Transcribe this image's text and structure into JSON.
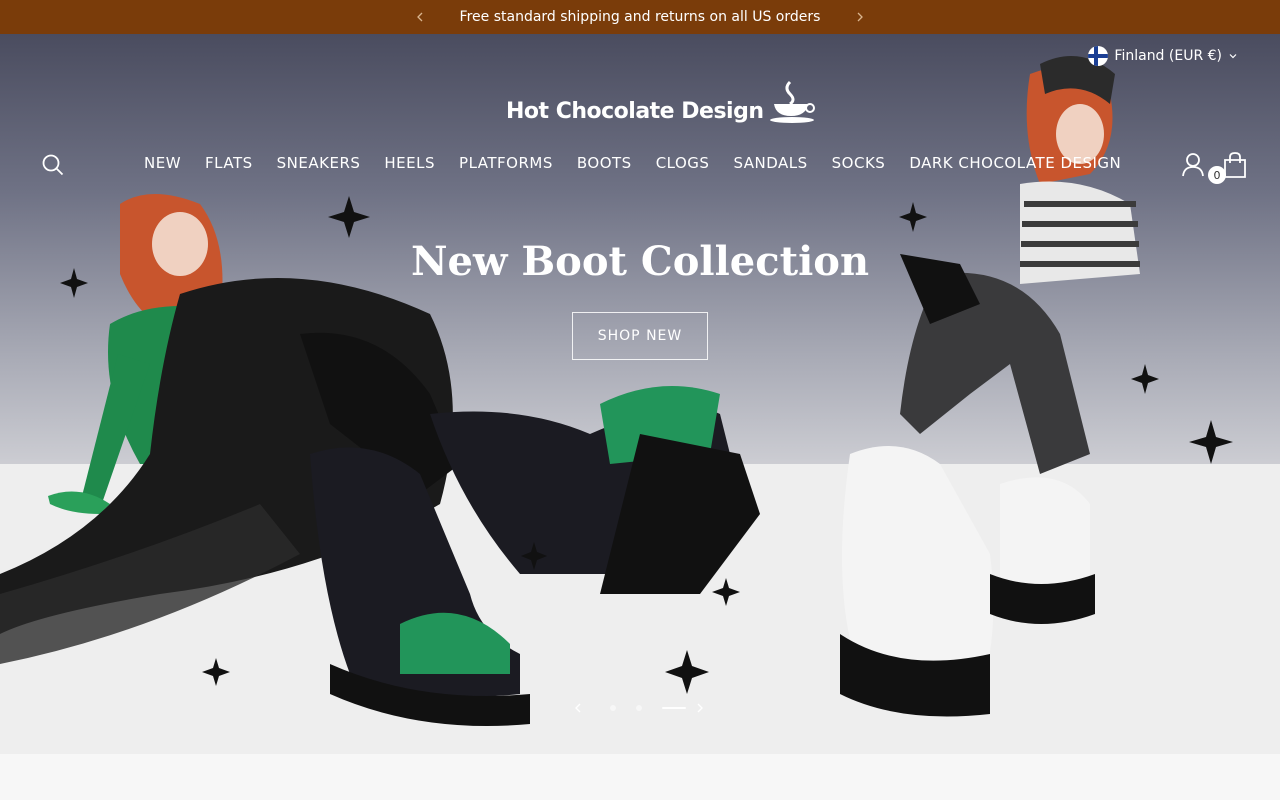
{
  "announcement": {
    "text": "Free standard shipping and returns on all US orders"
  },
  "region": {
    "label": "Finland (EUR €)"
  },
  "logo": {
    "text": "Hot Chocolate Design"
  },
  "nav": {
    "items": [
      "NEW",
      "FLATS",
      "SNEAKERS",
      "HEELS",
      "PLATFORMS",
      "BOOTS",
      "CLOGS",
      "SANDALS",
      "SOCKS",
      "DARK CHOCOLATE DESIGN"
    ]
  },
  "cart": {
    "count": "0"
  },
  "hero": {
    "headline": "New Boot Collection",
    "cta": "SHOP NEW"
  },
  "slider": {
    "slides": 3,
    "active": 3
  },
  "colors": {
    "announcement_bg": "#7a3c0a",
    "accent_green": "#1f8a4c"
  }
}
